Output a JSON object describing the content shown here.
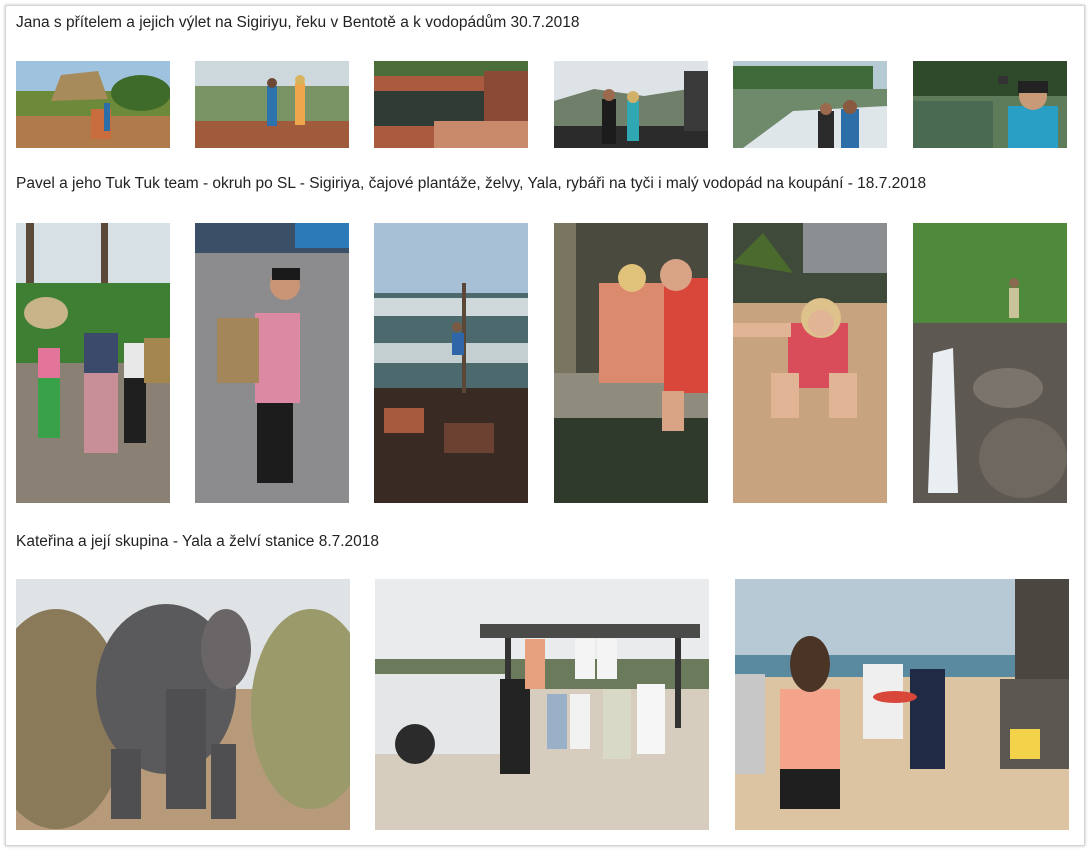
{
  "sections": [
    {
      "title": "Jana s přítelem a jejich výlet na Sigiriyu, řeku v Bentotě a k vodopádům 30.7.2018",
      "photos": [
        {
          "subject": "sigiriya-rock"
        },
        {
          "subject": "hill-viewpoint"
        },
        {
          "subject": "ancient-pool"
        },
        {
          "subject": "couple-balcony"
        },
        {
          "subject": "river-boat"
        },
        {
          "subject": "boat-selfie"
        }
      ]
    },
    {
      "title": "Pavel a jeho Tuk Tuk team - okruh po SL - Sigiriya, čajové plantáže, želvy, Yala, rybáři na tyči i malý vodopád na koupání - 18.7.2018",
      "photos": [
        {
          "subject": "tea-pickers"
        },
        {
          "subject": "woman-with-basket"
        },
        {
          "subject": "stilt-fisherman"
        },
        {
          "subject": "turtle-tank"
        },
        {
          "subject": "girl-on-beach"
        },
        {
          "subject": "waterfall"
        }
      ]
    },
    {
      "title": "Kateřina a její skupina - Yala a želví stanice 8.7.2018",
      "photos": [
        {
          "subject": "elephant"
        },
        {
          "subject": "safari-jeep-group"
        },
        {
          "subject": "beach-group"
        }
      ]
    }
  ],
  "colors": {
    "background": "#ffffff",
    "frame_border": "#d4d4d4",
    "text": "#222222"
  }
}
